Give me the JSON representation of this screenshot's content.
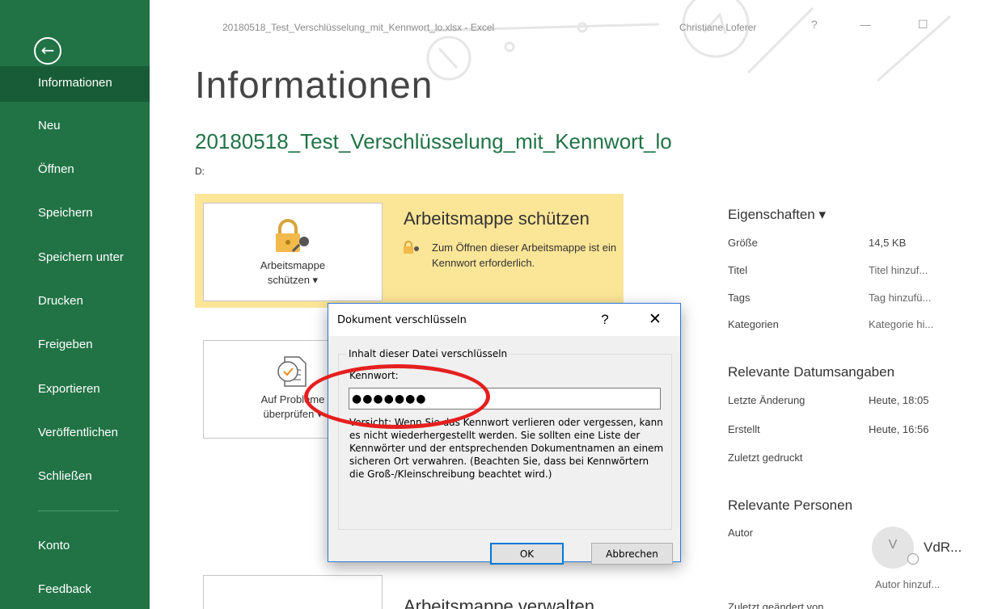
{
  "titlebar": {
    "document_title": "20180518_Test_Verschlüsselung_mit_Kennwort_lo.xlsx  -  Excel",
    "user": "Christiane Loferer",
    "help_glyph": "?",
    "minimize_glyph": "—",
    "maximize_glyph": "☐"
  },
  "sidebar": {
    "back_glyph": "←",
    "items": [
      {
        "label": "Informationen",
        "active": true
      },
      {
        "label": "Neu"
      },
      {
        "label": "Öffnen"
      },
      {
        "label": "Speichern"
      },
      {
        "label": "Speichern unter"
      },
      {
        "label": "Drucken"
      },
      {
        "label": "Freigeben"
      },
      {
        "label": "Exportieren"
      },
      {
        "label": "Veröffentlichen"
      },
      {
        "label": "Schließen"
      },
      {
        "label": "Konto"
      },
      {
        "label": "Feedback"
      }
    ]
  },
  "main": {
    "page_title": "Informationen",
    "file_name": "20180518_Test_Verschlüsselung_mit_Kennwort_lo",
    "file_path": "D:",
    "protect": {
      "button_label_line1": "Arbeitsmappe",
      "button_label_line2": "schützen ▾",
      "heading": "Arbeitsmappe schützen",
      "description": "Zum Öffnen dieser Arbeitsmappe ist ein Kennwort erforderlich."
    },
    "check": {
      "button_label_line1": "Auf Probleme",
      "button_label_line2": "überprüfen ▾"
    },
    "manage": {
      "heading": "Arbeitsmappe verwalten"
    }
  },
  "properties": {
    "heading": "Eigenschaften ▾",
    "rows": [
      {
        "key": "Größe",
        "value": "14,5 KB"
      },
      {
        "key": "Titel",
        "value": "Titel hinzuf..."
      },
      {
        "key": "Tags",
        "value": "Tag hinzufü..."
      },
      {
        "key": "Kategorien",
        "value": "Kategorie hi..."
      }
    ],
    "dates_heading": "Relevante Datumsangaben",
    "dates": [
      {
        "key": "Letzte Änderung",
        "value": "Heute, 18:05"
      },
      {
        "key": "Erstellt",
        "value": "Heute, 16:56"
      },
      {
        "key": "Zuletzt gedruckt",
        "value": ""
      }
    ],
    "people_heading": "Relevante Personen",
    "author_key": "Autor",
    "author_initial": "V",
    "author_name": "VdR...",
    "author_add": "Autor hinzuf...",
    "last_modified_by_key": "Zuletzt geändert von"
  },
  "dialog": {
    "title": "Dokument verschlüsseln",
    "help_glyph": "?",
    "close_glyph": "✕",
    "group_label": "Inhalt dieser Datei verschlüsseln",
    "password_label": "Kennwort:",
    "password_value": "●●●●●●●",
    "warning": "Vorsicht: Wenn Sie das Kennwort verlieren oder vergessen, kann es nicht wiederhergestellt werden. Sie sollten eine Liste der Kennwörter und der entsprechenden Dokumentnamen an einem sicheren Ort verwahren. (Beachten Sie, dass bei Kennwörtern die Groß-/Kleinschreibung beachtet wird.)",
    "ok_label": "OK",
    "cancel_label": "Abbrechen"
  },
  "colors": {
    "accent": "#217346",
    "sidebar_active": "#185c37",
    "protect_highlight": "#fbe597",
    "annotation": "#e51f1f"
  }
}
